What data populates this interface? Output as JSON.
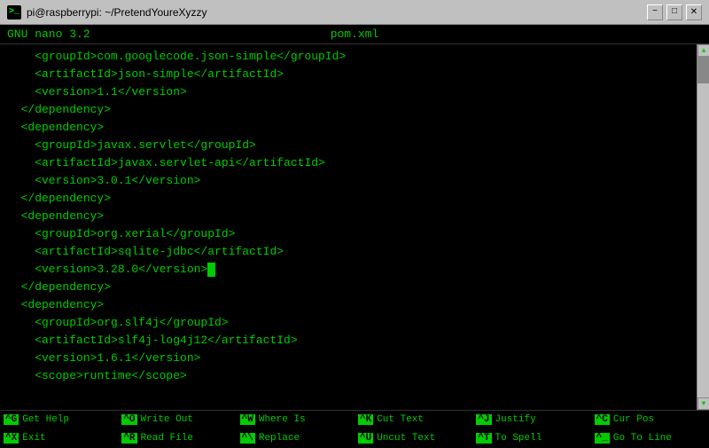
{
  "titlebar": {
    "icon_char": ">_",
    "title": "pi@raspberrypi: ~/PretendYoureXyzzy",
    "minimize_label": "−",
    "maximize_label": "□",
    "close_label": "✕"
  },
  "nano": {
    "header_left": "GNU nano 3.2",
    "header_center": "pom.xml"
  },
  "editor": {
    "lines": [
      "    <groupId>com.googlecode.json-simple</groupId>",
      "    <artifactId>json-simple</artifactId>",
      "    <version>1.1</version>",
      "  </dependency>",
      "  <dependency>",
      "    <groupId>javax.servlet</groupId>",
      "    <artifactId>javax.servlet-api</artifactId>",
      "    <version>3.0.1</version>",
      "  </dependency>",
      "  <dependency>",
      "    <groupId>org.xerial</groupId>",
      "    <artifactId>sqlite-jdbc</artifactId>",
      "    <version>3.28.0</version>",
      "  </dependency>",
      "  <dependency>",
      "    <groupId>org.slf4j</groupId>",
      "    <artifactId>slf4j-log4j12</artifactId>",
      "    <version>1.6.1</version>",
      "    <scope>runtime</scope>",
      ""
    ],
    "cursor_line": 12,
    "cursor_after": "    <version>3.28.0</version>"
  },
  "footer": {
    "items": [
      {
        "key": "^G",
        "label": "Get Help"
      },
      {
        "key": "^O",
        "label": "Write Out"
      },
      {
        "key": "^W",
        "label": "Where Is"
      },
      {
        "key": "^K",
        "label": "Cut Text"
      },
      {
        "key": "^J",
        "label": "Justify"
      },
      {
        "key": "^C",
        "label": "Cur Pos"
      },
      {
        "key": "^X",
        "label": "Exit"
      },
      {
        "key": "^R",
        "label": "Read File"
      },
      {
        "key": "^\\",
        "label": "Replace"
      },
      {
        "key": "^U",
        "label": "Uncut Text"
      },
      {
        "key": "^T",
        "label": "To Spell"
      },
      {
        "key": "^_",
        "label": "Go To Line"
      }
    ]
  }
}
